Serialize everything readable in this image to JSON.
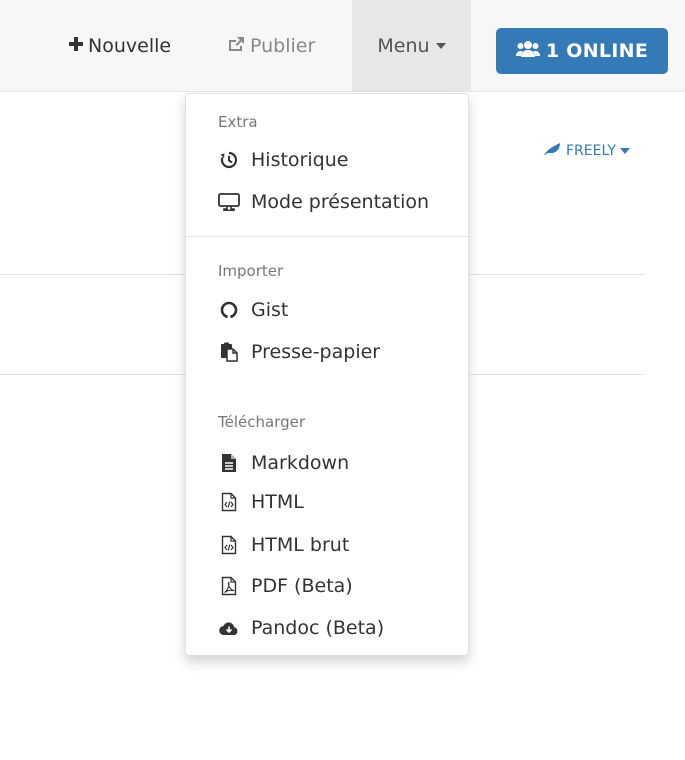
{
  "toolbar": {
    "new_label": "Nouvelle",
    "publish_label": "Publier",
    "menu_label": "Menu",
    "online_label": "1 ONLINE"
  },
  "permission": {
    "label": "FREELY"
  },
  "menu": {
    "extra_header": "Extra",
    "history": "Historique",
    "presentation": "Mode présentation",
    "import_header": "Importer",
    "gist": "Gist",
    "clipboard": "Presse-papier",
    "download_header": "Télécharger",
    "markdown": "Markdown",
    "html": "HTML",
    "raw_html": "HTML brut",
    "pdf": "PDF (Beta)",
    "pandoc": "Pandoc (Beta)"
  },
  "icons": {
    "new": "plus-icon",
    "publish": "share-icon",
    "online": "users-icon",
    "freely": "leaf-icon",
    "history": "history-icon",
    "presentation": "desktop-icon",
    "gist": "github-icon",
    "clipboard": "clipboard-icon",
    "markdown": "file-text-icon",
    "html": "file-code-icon",
    "raw_html": "file-code-icon",
    "pdf": "file-pdf-icon",
    "pandoc": "cloud-download-icon"
  },
  "colors": {
    "accent": "#337ab7",
    "topbar_bg": "#f7f7f7",
    "menu_active_bg": "#e7e7e7"
  }
}
